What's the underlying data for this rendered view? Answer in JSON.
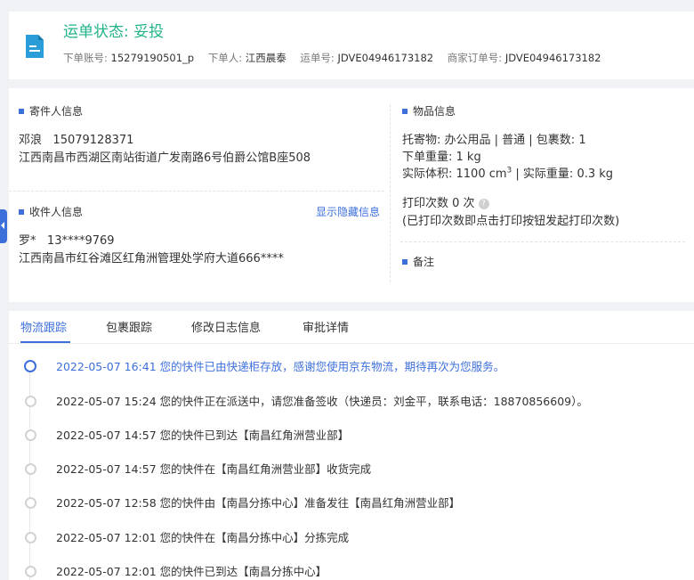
{
  "header": {
    "status_label": "运单状态:",
    "status_value": "妥投",
    "account_label": "下单账号:",
    "account_value": "15279190501_p",
    "orderer_label": "下单人:",
    "orderer_value": "江西晨泰",
    "waybill_label": "运单号:",
    "waybill_value": "JDVE04946173182",
    "merchant_label": "商家订单号:",
    "merchant_value": "JDVE04946173182"
  },
  "sender": {
    "title": "寄件人信息",
    "name": "邓浪",
    "phone": "15079128371",
    "address": "江西南昌市西湖区南站街道广发南路6号伯爵公馆B座508"
  },
  "receiver": {
    "title": "收件人信息",
    "show_hidden": "显示隐藏信息",
    "name": "罗*",
    "phone": "13****9769",
    "address": "江西南昌市红谷滩区红角洲管理处学府大道666****"
  },
  "goods": {
    "title": "物品信息",
    "line1": "托寄物:  办公用品 | 普通  |  包裹数:  1",
    "line2": "下单重量:  1 kg",
    "volume_label": "实际体积:   1100 cm",
    "volume_sup": "3",
    "volume_rest": " |  实际重量:   0.3 kg",
    "print_count": "打印次数   0 次",
    "print_note": "(已打印次数即点击打印按钮发起打印次数)",
    "help_icon": "?"
  },
  "remark": {
    "title": "备注"
  },
  "tabs": [
    "物流跟踪",
    "包裹跟踪",
    "修改日志信息",
    "审批详情"
  ],
  "timeline": [
    {
      "time": "2022-05-07 16:41",
      "text": "您的快件已由快递柜存放，感谢您使用京东物流，期待再次为您服务。"
    },
    {
      "time": "2022-05-07 15:24",
      "text": "您的快件正在派送中，请您准备签收（快递员：刘金平，联系电话：18870856609）。"
    },
    {
      "time": "2022-05-07 14:57",
      "text": "您的快件已到达【南昌红角洲营业部】"
    },
    {
      "time": "2022-05-07 14:57",
      "text": "您的快件在【南昌红角洲营业部】收货完成"
    },
    {
      "time": "2022-05-07 12:58",
      "text": "您的快件由【南昌分拣中心】准备发往【南昌红角洲营业部】"
    },
    {
      "time": "2022-05-07 12:01",
      "text": "您的快件在【南昌分拣中心】分拣完成"
    },
    {
      "time": "2022-05-07 12:01",
      "text": "您的快件已到达【南昌分拣中心】"
    }
  ],
  "colors": {
    "accent": "#3d6fdb",
    "status": "#22b38a"
  },
  "icons": {
    "header_icon": "document-icon",
    "side_tab": "collapse-arrow-icon"
  }
}
